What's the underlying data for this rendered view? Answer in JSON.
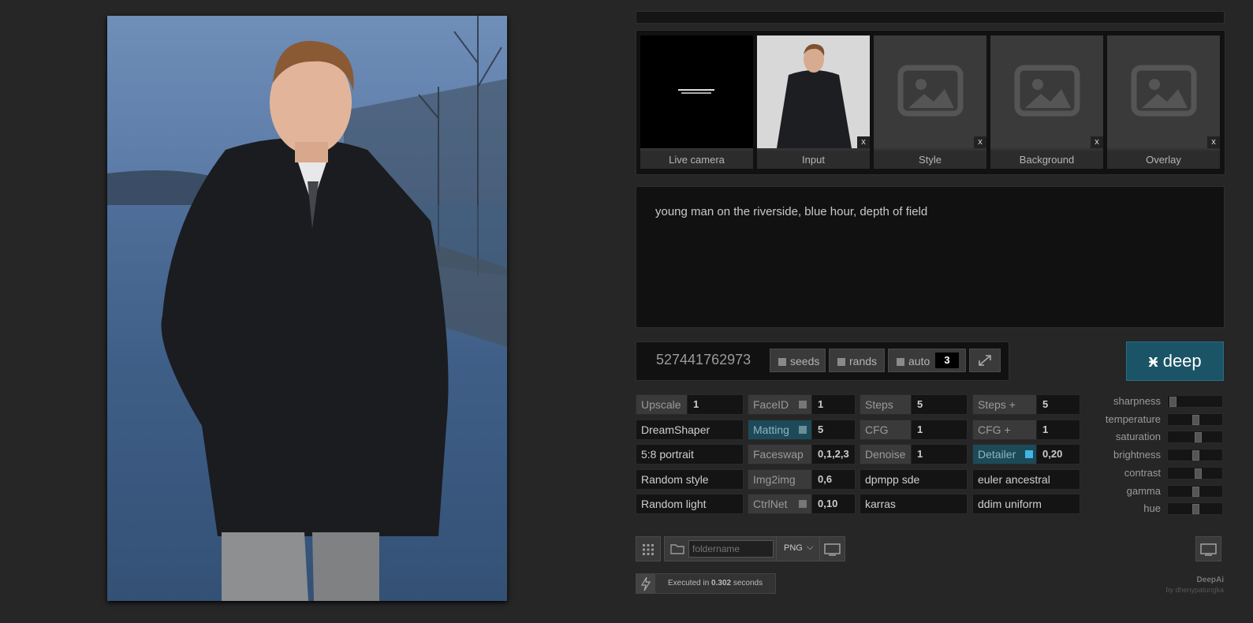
{
  "thumbs": [
    {
      "caption": "Live camera",
      "closable": false
    },
    {
      "caption": "Input",
      "closable": true
    },
    {
      "caption": "Style",
      "closable": true
    },
    {
      "caption": "Background",
      "closable": true
    },
    {
      "caption": "Overlay",
      "closable": true
    }
  ],
  "close_glyph": "x",
  "prompt": "young man on the riverside, blue hour, depth of field",
  "seed": "527441762973",
  "seed_buttons": {
    "seeds": "seeds",
    "rands": "rands",
    "auto": "auto",
    "auto_value": "3"
  },
  "deep_button": "deep",
  "grid": [
    [
      {
        "label": "Upscale",
        "value": "1"
      },
      {
        "label": "FaceID",
        "value": "1",
        "indicator": true
      },
      {
        "label": "Steps",
        "value": "5"
      },
      {
        "label": "Steps +",
        "value": "5"
      }
    ],
    [
      {
        "label": "DreamShaper"
      },
      {
        "label": "Matting",
        "value": "5",
        "indicator": true,
        "active": true
      },
      {
        "label": "CFG",
        "value": "1"
      },
      {
        "label": "CFG +",
        "value": "1"
      }
    ],
    [
      {
        "label": "5:8 portrait"
      },
      {
        "label": "Faceswap",
        "value": "0,1,2,3"
      },
      {
        "label": "Denoise",
        "value": "1"
      },
      {
        "label": "Detailer",
        "value": "0,20",
        "indicator": true,
        "active": true
      }
    ],
    [
      {
        "label": "Random style"
      },
      {
        "label": "Img2img",
        "value": "0,6"
      },
      {
        "label": "dpmpp sde"
      },
      {
        "label": "euler ancestral"
      }
    ],
    [
      {
        "label": "Random light"
      },
      {
        "label": "CtrlNet",
        "value": "0,10",
        "indicator": true
      },
      {
        "label": "karras"
      },
      {
        "label": "ddim uniform"
      }
    ]
  ],
  "sliders": [
    {
      "label": "sharpness",
      "level": 0.0
    },
    {
      "label": "temperature",
      "level": 0.5
    },
    {
      "label": "saturation",
      "level": 0.55
    },
    {
      "label": "brightness",
      "level": 0.5
    },
    {
      "label": "contrast",
      "level": 0.55
    },
    {
      "label": "gamma",
      "level": 0.5
    },
    {
      "label": "hue",
      "level": 0.5
    }
  ],
  "folder_placeholder": "foldername",
  "format_select": {
    "selected": "PNG"
  },
  "status": {
    "prefix": "Executed in",
    "time": "0.302",
    "suffix": "seconds"
  },
  "brand": {
    "name": "DeepAi",
    "byline": "by dhenypatungka"
  },
  "colors": {
    "accent": "#1a5466",
    "detailer_indicator": "#3fb6e6",
    "matting_indicator": "#6b8e99"
  }
}
